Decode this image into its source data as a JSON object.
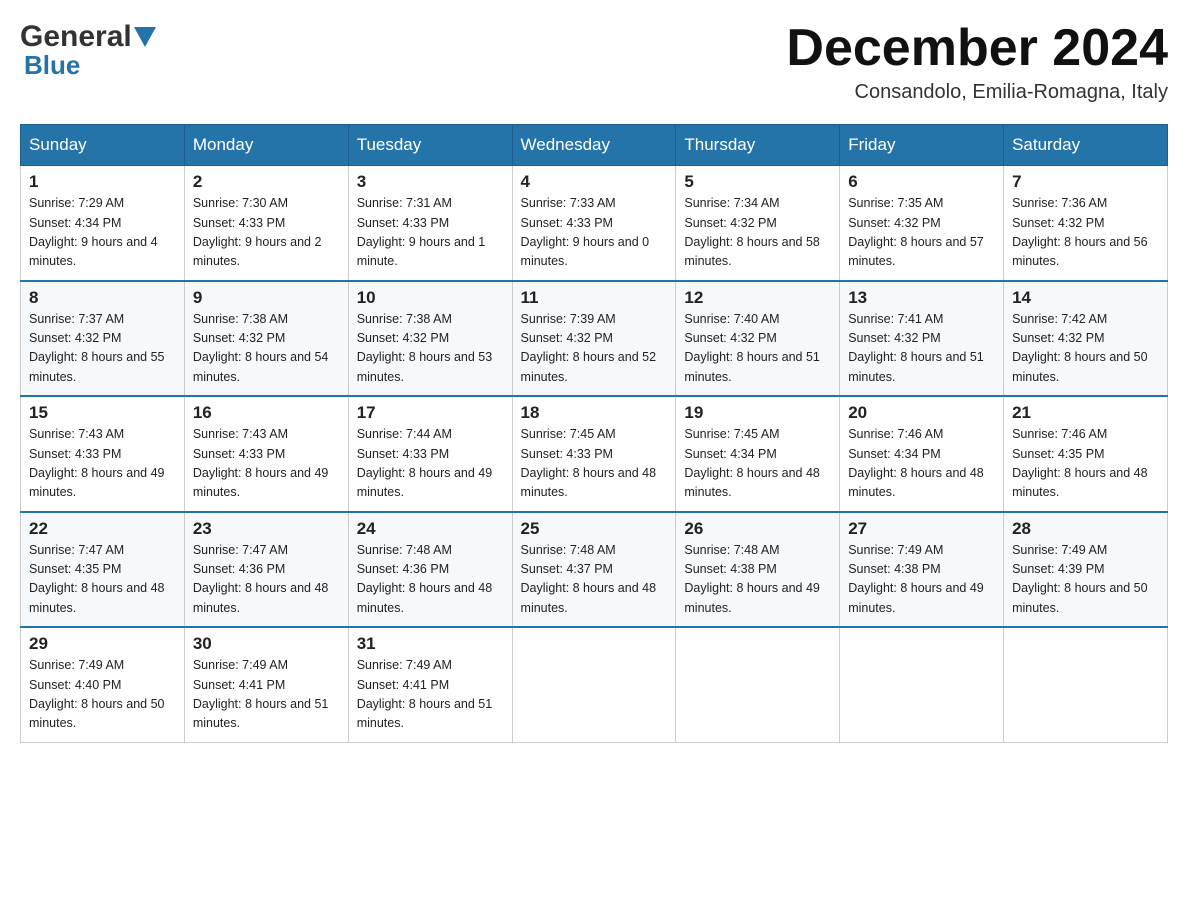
{
  "header": {
    "logo_general": "General",
    "logo_blue": "Blue",
    "month_title": "December 2024",
    "location": "Consandolo, Emilia-Romagna, Italy"
  },
  "weekdays": [
    "Sunday",
    "Monday",
    "Tuesday",
    "Wednesday",
    "Thursday",
    "Friday",
    "Saturday"
  ],
  "weeks": [
    [
      {
        "day": "1",
        "sunrise": "7:29 AM",
        "sunset": "4:34 PM",
        "daylight": "9 hours and 4 minutes."
      },
      {
        "day": "2",
        "sunrise": "7:30 AM",
        "sunset": "4:33 PM",
        "daylight": "9 hours and 2 minutes."
      },
      {
        "day": "3",
        "sunrise": "7:31 AM",
        "sunset": "4:33 PM",
        "daylight": "9 hours and 1 minute."
      },
      {
        "day": "4",
        "sunrise": "7:33 AM",
        "sunset": "4:33 PM",
        "daylight": "9 hours and 0 minutes."
      },
      {
        "day": "5",
        "sunrise": "7:34 AM",
        "sunset": "4:32 PM",
        "daylight": "8 hours and 58 minutes."
      },
      {
        "day": "6",
        "sunrise": "7:35 AM",
        "sunset": "4:32 PM",
        "daylight": "8 hours and 57 minutes."
      },
      {
        "day": "7",
        "sunrise": "7:36 AM",
        "sunset": "4:32 PM",
        "daylight": "8 hours and 56 minutes."
      }
    ],
    [
      {
        "day": "8",
        "sunrise": "7:37 AM",
        "sunset": "4:32 PM",
        "daylight": "8 hours and 55 minutes."
      },
      {
        "day": "9",
        "sunrise": "7:38 AM",
        "sunset": "4:32 PM",
        "daylight": "8 hours and 54 minutes."
      },
      {
        "day": "10",
        "sunrise": "7:38 AM",
        "sunset": "4:32 PM",
        "daylight": "8 hours and 53 minutes."
      },
      {
        "day": "11",
        "sunrise": "7:39 AM",
        "sunset": "4:32 PM",
        "daylight": "8 hours and 52 minutes."
      },
      {
        "day": "12",
        "sunrise": "7:40 AM",
        "sunset": "4:32 PM",
        "daylight": "8 hours and 51 minutes."
      },
      {
        "day": "13",
        "sunrise": "7:41 AM",
        "sunset": "4:32 PM",
        "daylight": "8 hours and 51 minutes."
      },
      {
        "day": "14",
        "sunrise": "7:42 AM",
        "sunset": "4:32 PM",
        "daylight": "8 hours and 50 minutes."
      }
    ],
    [
      {
        "day": "15",
        "sunrise": "7:43 AM",
        "sunset": "4:33 PM",
        "daylight": "8 hours and 49 minutes."
      },
      {
        "day": "16",
        "sunrise": "7:43 AM",
        "sunset": "4:33 PM",
        "daylight": "8 hours and 49 minutes."
      },
      {
        "day": "17",
        "sunrise": "7:44 AM",
        "sunset": "4:33 PM",
        "daylight": "8 hours and 49 minutes."
      },
      {
        "day": "18",
        "sunrise": "7:45 AM",
        "sunset": "4:33 PM",
        "daylight": "8 hours and 48 minutes."
      },
      {
        "day": "19",
        "sunrise": "7:45 AM",
        "sunset": "4:34 PM",
        "daylight": "8 hours and 48 minutes."
      },
      {
        "day": "20",
        "sunrise": "7:46 AM",
        "sunset": "4:34 PM",
        "daylight": "8 hours and 48 minutes."
      },
      {
        "day": "21",
        "sunrise": "7:46 AM",
        "sunset": "4:35 PM",
        "daylight": "8 hours and 48 minutes."
      }
    ],
    [
      {
        "day": "22",
        "sunrise": "7:47 AM",
        "sunset": "4:35 PM",
        "daylight": "8 hours and 48 minutes."
      },
      {
        "day": "23",
        "sunrise": "7:47 AM",
        "sunset": "4:36 PM",
        "daylight": "8 hours and 48 minutes."
      },
      {
        "day": "24",
        "sunrise": "7:48 AM",
        "sunset": "4:36 PM",
        "daylight": "8 hours and 48 minutes."
      },
      {
        "day": "25",
        "sunrise": "7:48 AM",
        "sunset": "4:37 PM",
        "daylight": "8 hours and 48 minutes."
      },
      {
        "day": "26",
        "sunrise": "7:48 AM",
        "sunset": "4:38 PM",
        "daylight": "8 hours and 49 minutes."
      },
      {
        "day": "27",
        "sunrise": "7:49 AM",
        "sunset": "4:38 PM",
        "daylight": "8 hours and 49 minutes."
      },
      {
        "day": "28",
        "sunrise": "7:49 AM",
        "sunset": "4:39 PM",
        "daylight": "8 hours and 50 minutes."
      }
    ],
    [
      {
        "day": "29",
        "sunrise": "7:49 AM",
        "sunset": "4:40 PM",
        "daylight": "8 hours and 50 minutes."
      },
      {
        "day": "30",
        "sunrise": "7:49 AM",
        "sunset": "4:41 PM",
        "daylight": "8 hours and 51 minutes."
      },
      {
        "day": "31",
        "sunrise": "7:49 AM",
        "sunset": "4:41 PM",
        "daylight": "8 hours and 51 minutes."
      },
      null,
      null,
      null,
      null
    ]
  ]
}
